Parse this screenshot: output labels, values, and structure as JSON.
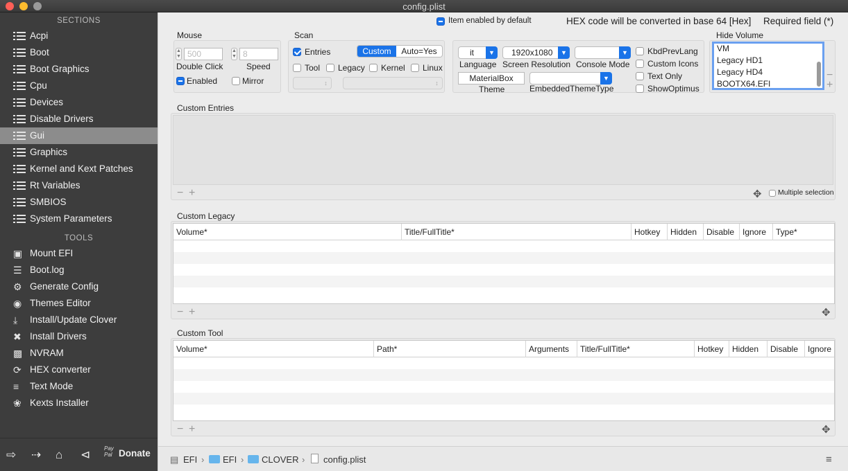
{
  "window": {
    "title": "config.plist"
  },
  "sidebar": {
    "sections_header": "SECTIONS",
    "sections": [
      "Acpi",
      "Boot",
      "Boot Graphics",
      "Cpu",
      "Devices",
      "Disable Drivers",
      "Gui",
      "Graphics",
      "Kernel and Kext Patches",
      "Rt Variables",
      "SMBIOS",
      "System Parameters"
    ],
    "selected": "Gui",
    "tools_header": "TOOLS",
    "tools": [
      {
        "label": "Mount EFI",
        "icon": "disk-icon"
      },
      {
        "label": "Boot.log",
        "icon": "log-search-icon"
      },
      {
        "label": "Generate Config",
        "icon": "gears-icon"
      },
      {
        "label": "Themes Editor",
        "icon": "palette-icon"
      },
      {
        "label": "Install/Update Clover",
        "icon": "download-icon"
      },
      {
        "label": "Install Drivers",
        "icon": "tools-icon"
      },
      {
        "label": "NVRAM",
        "icon": "chip-icon"
      },
      {
        "label": "HEX converter",
        "icon": "convert-icon"
      },
      {
        "label": "Text Mode",
        "icon": "text-icon"
      },
      {
        "label": "Kexts Installer",
        "icon": "plug-icon"
      }
    ],
    "bottom": {
      "paypal": "Pay Pal",
      "donate": "Donate"
    }
  },
  "header": {
    "item_enabled": "Item enabled by default",
    "hex_note": "HEX code will be converted in base 64 [Hex]",
    "required": "Required field (*)"
  },
  "mouse": {
    "title": "Mouse",
    "double_click_value": "500",
    "double_click_label": "Double Click",
    "speed_value": "8",
    "speed_label": "Speed",
    "enabled_label": "Enabled",
    "mirror_label": "Mirror"
  },
  "scan": {
    "title": "Scan",
    "entries_label": "Entries",
    "seg_custom": "Custom",
    "seg_auto": "Auto=Yes",
    "tool_label": "Tool",
    "legacy_label": "Legacy",
    "kernel_label": "Kernel",
    "linux_label": "Linux"
  },
  "gui": {
    "language_value": "it",
    "language_label": "Language",
    "resolution_value": "1920x1080",
    "resolution_label": "Screen Resolution",
    "console_mode_label": "Console Mode",
    "theme_value": "MaterialBox",
    "theme_label": "Theme",
    "embedded_label": "EmbeddedThemeType",
    "kbd_label": "KbdPrevLang",
    "custom_icons_label": "Custom Icons",
    "text_only_label": "Text Only",
    "show_optimus_label": "ShowOptimus"
  },
  "hide_volume": {
    "title": "Hide Volume",
    "items": [
      "VM",
      "Legacy HD1",
      "Legacy HD4",
      "BOOTX64.EFI"
    ]
  },
  "custom_entries": {
    "title": "Custom Entries",
    "multiple_selection": "Multiple selection"
  },
  "custom_legacy": {
    "title": "Custom Legacy",
    "columns": [
      "Volume*",
      "Title/FullTitle*",
      "Hotkey",
      "Hidden",
      "Disable",
      "Ignore",
      "Type*"
    ]
  },
  "custom_tool": {
    "title": "Custom Tool",
    "columns": [
      "Volume*",
      "Path*",
      "Arguments",
      "Title/FullTitle*",
      "Hotkey",
      "Hidden",
      "Disable",
      "Ignore"
    ]
  },
  "footer": {
    "path": [
      "EFI",
      "EFI",
      "CLOVER",
      "config.plist"
    ]
  },
  "colors": {
    "accent": "#1a73e8",
    "sidebar_bg": "#3d3d3d",
    "selected_bg": "#8c8c8c"
  }
}
